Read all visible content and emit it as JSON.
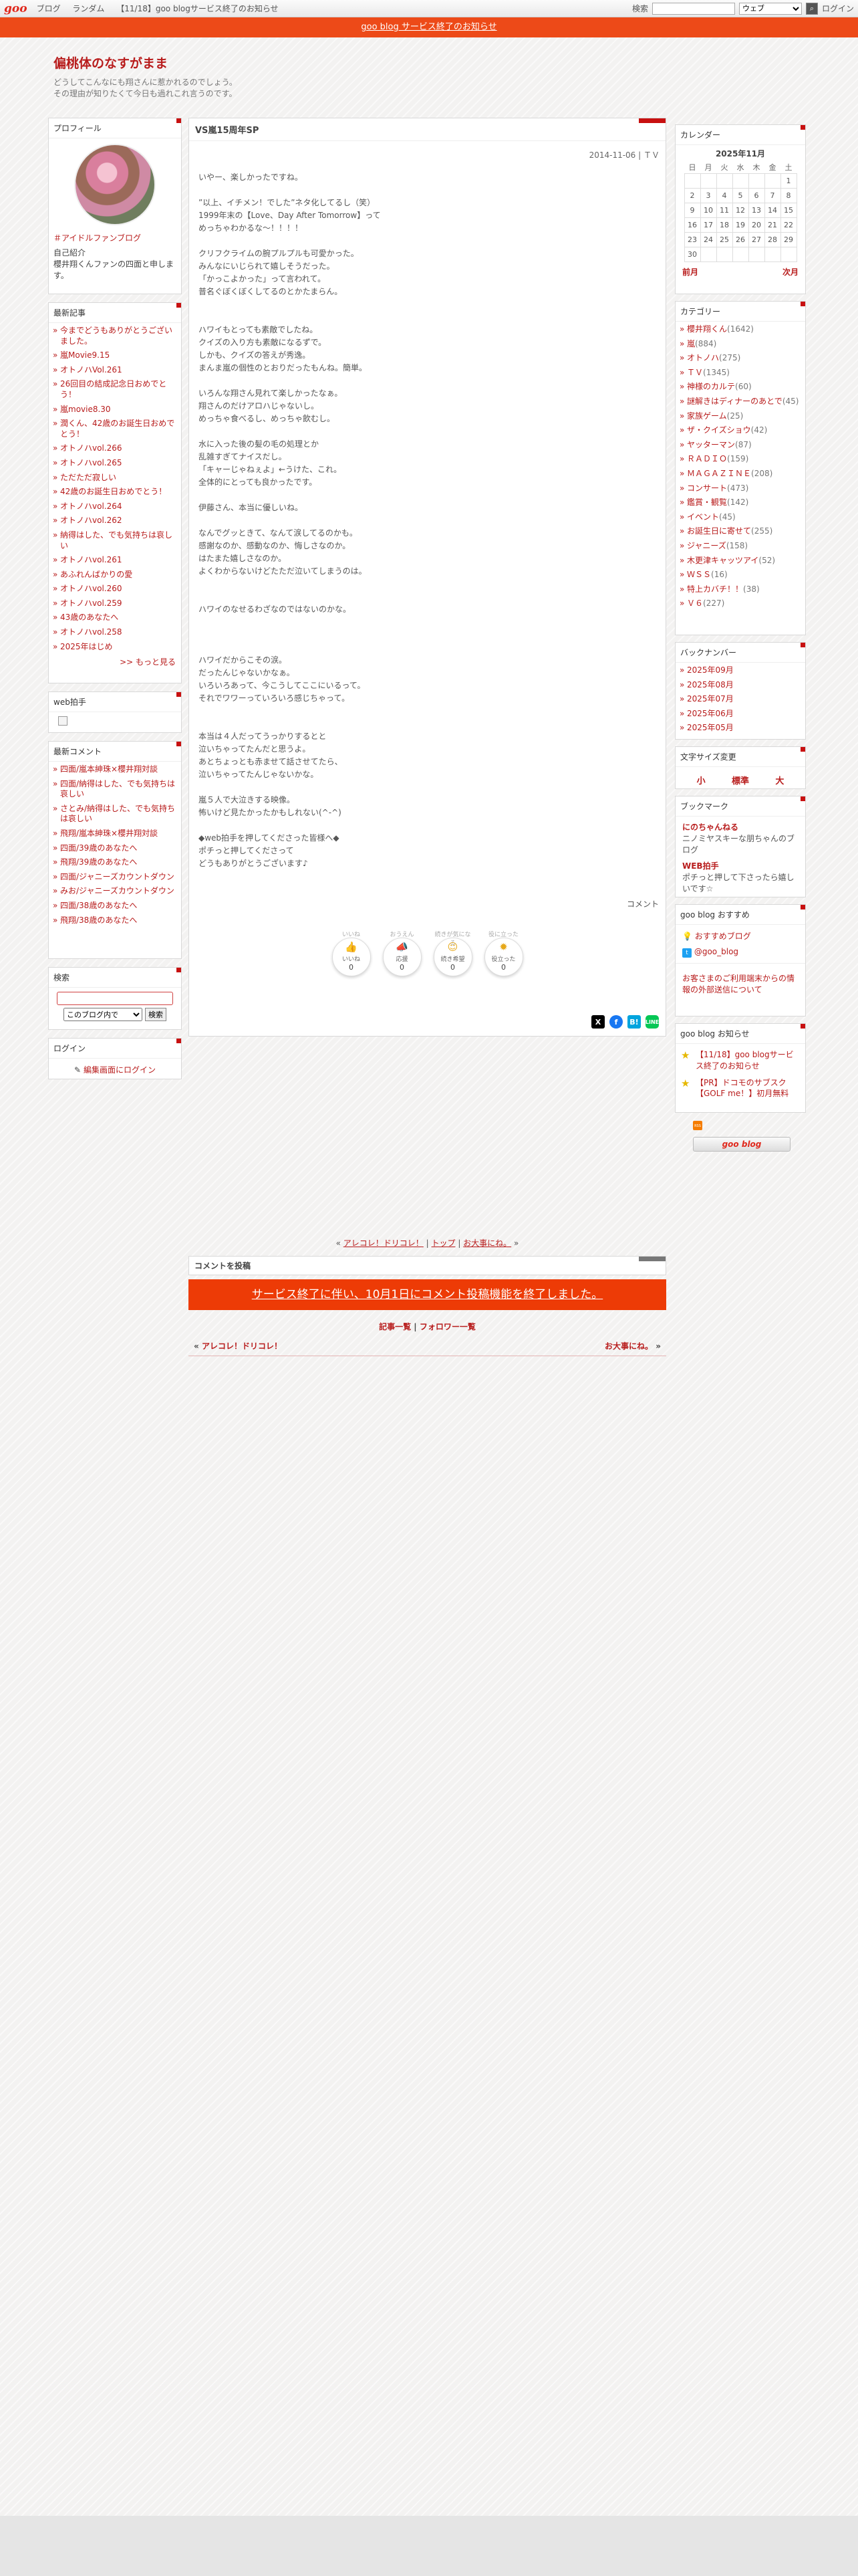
{
  "topbar": {
    "logo": "goo",
    "nav": [
      "ブログ",
      "ランダム",
      "【11/18】goo blogサービス終了のお知らせ"
    ],
    "search_label": "検索",
    "search_scope": "ウェブ",
    "login_label": "ログイン"
  },
  "notice": "goo blog サービス終了のお知らせ",
  "blog": {
    "title": "偏桃体のなすがまま",
    "desc1": "どうしてこんなにも翔さんに惹かれるのでしょう。",
    "desc2": "その理由が知りたくて今日も過れこれ言うのです。"
  },
  "profile": {
    "heading": "プロフィール",
    "link": "＃アイドルファンブログ",
    "intro_label": "自己紹介",
    "intro_text": "櫻井翔くんファンの四面と申します。"
  },
  "recent": {
    "heading": "最新記事",
    "items": [
      "今までどうもありがとうございました。",
      "嵐Movie9.15",
      "オトノハVol.261",
      "26回目の結成記念日おめでとう！",
      "嵐movie8.30",
      "潤くん、42歳のお誕生日おめでとう！",
      "オトノハvol.266",
      "オトノハvol.265",
      "ただただ寂しい",
      "42歳のお誕生日おめでとう！",
      "オトノハvol.264",
      "オトノハvol.262",
      "納得はした、でも気持ちは哀しい",
      "オトノハvol.261",
      "あふれんばかりの愛",
      "オトノハvol.260",
      "オトノハvol.259",
      "43歳のあなたへ",
      "オトノハvol.258",
      "2025年はじめ"
    ],
    "more": ">> もっと見る"
  },
  "webclap": {
    "heading": "web拍手"
  },
  "comments": {
    "heading": "最新コメント",
    "items": [
      "四面/嵐本紳珠×櫻井翔対談",
      "四面/納得はした、でも気持ちは哀しい",
      "さとみ/納得はした、でも気持ちは哀しい",
      "飛翔/嵐本紳珠×櫻井翔対談",
      "四面/39歳のあなたへ",
      "飛翔/39歳のあなたへ",
      "四面/ジャニーズカウントダウン",
      "みお/ジャニーズカウントダウン",
      "四面/38歳のあなたへ",
      "飛翔/38歳のあなたへ"
    ]
  },
  "search_box": {
    "heading": "検索",
    "scope": "このブログ内で",
    "button": "検索"
  },
  "login_box": {
    "heading": "ログイン",
    "link": "編集画面にログイン"
  },
  "article": {
    "title": "VS嵐15周年SP",
    "meta": "2014-11-06 | ＴＶ",
    "lines": [
      "いやー、楽しかったですね。",
      "",
      "”以上、イチメン！でした”ネタ化してるし（笑）",
      "1999年末の【Love、Day After Tomorrow】って",
      "めっちゃわかるな～！！！！",
      "",
      "クリフクライムの腕プルプルも可愛かった。",
      "みんなにいじられて嬉しそうだった。",
      "「かっこよかった」って言われて。",
      "普名ぐぼくぼくしてるのとかたまらん。",
      "",
      "",
      "ハワイもとっても素敵でしたね。",
      "クイズの入り方も素敵になるずで。",
      "しかも、クイズの答えが秀逸。",
      "まんま嵐の個性のとおりだったもんね。簡単。",
      "",
      "いろんな翔さん見れて楽しかったなぁ。",
      "翔さんのだけアロハじゃないし。",
      "めっちゃ食べるし、めっちゃ飲むし。",
      "",
      "水に入った後の髪の毛の処理とか",
      "乱雑すぎてナイスだし。",
      "「キャーじゃねぇよ」←うけた、これ。",
      "全体的にとっても良かったです。",
      "",
      "伊藤さん、本当に優しいね。",
      "",
      "なんでグッときて、なんて涙してるのかも。",
      "感謝なのか、感動なのか、悔しさなのか。",
      "はたまた嬉しさなのか。",
      "よくわからないけどたただ泣いてしまうのは。",
      "",
      "",
      "ハワイのなせるわざなのではないのかな。",
      "",
      "",
      "",
      "ハワイだからこその涙。",
      "だったんじゃないかなぁ。",
      "いろいろあって、今こうしてここにいるって。",
      "それでワワーっていろいろ感じちゃって。",
      "",
      "",
      "本当は４人だってうっかりするとと",
      "泣いちゃってたんだと思うよ。",
      "あとちょっとも赤ませて話させてたら、",
      "泣いちゃってたんじゃないかな。",
      "",
      "嵐５人で大泣きする映像。",
      "怖いけど見たかったかもしれない(^-^)",
      "",
      "◆web拍手を押してくださった皆様へ◆",
      "ポチっと押してくださって",
      "どうもありがとうございます♪"
    ],
    "comment_link": "コメント",
    "reactions": [
      {
        "top": "いいね",
        "icon": "thumbs-up-icon",
        "glyph": "👍",
        "label": "いいね",
        "count": "0"
      },
      {
        "top": "おうえん",
        "icon": "megaphone-icon",
        "glyph": "📣",
        "label": "応援",
        "count": "0"
      },
      {
        "top": "続きが気になる",
        "icon": "smile-icon",
        "glyph": "☺",
        "label": "続き希望",
        "count": "0"
      },
      {
        "top": "役に立った",
        "icon": "lightbulb-icon",
        "glyph": "✹",
        "label": "役立った",
        "count": "0"
      }
    ],
    "share": {
      "x": "X",
      "facebook": "f",
      "hatena": "B!",
      "line": "LINE"
    }
  },
  "pager": {
    "prev": "アレコレ！ドリコレ！",
    "top": "トップ",
    "next": "お大事にね。"
  },
  "post_comment": {
    "heading": "コメントを投稿",
    "notice": "サービス終了に伴い、10月1日にコメント投稿機能を終了しました。",
    "links": [
      "記事一覧",
      "フォロワー一覧"
    ],
    "prev": "アレコレ！ドリコレ！",
    "next": "お大事にね。"
  },
  "calendar": {
    "heading": "カレンダー",
    "month": "2025年11月",
    "weekdays": [
      "日",
      "月",
      "火",
      "水",
      "木",
      "金",
      "土"
    ],
    "weeks": [
      [
        "",
        "",
        "",
        "",
        "",
        "",
        "1"
      ],
      [
        "2",
        "3",
        "4",
        "5",
        "6",
        "7",
        "8"
      ],
      [
        "9",
        "10",
        "11",
        "12",
        "13",
        "14",
        "15"
      ],
      [
        "16",
        "17",
        "18",
        "19",
        "20",
        "21",
        "22"
      ],
      [
        "23",
        "24",
        "25",
        "26",
        "27",
        "28",
        "29"
      ],
      [
        "30",
        "",
        "",
        "",
        "",
        "",
        ""
      ]
    ],
    "prev": "前月",
    "next": "次月"
  },
  "categories": {
    "heading": "カテゴリー",
    "items": [
      {
        "name": "櫻井翔くん",
        "count": "(1642)"
      },
      {
        "name": "嵐",
        "count": "(884)"
      },
      {
        "name": "オトノハ",
        "count": "(275)"
      },
      {
        "name": "ＴＶ",
        "count": "(1345)"
      },
      {
        "name": "神様のカルテ",
        "count": "(60)"
      },
      {
        "name": "謎解きはディナーのあとで",
        "count": "(45)"
      },
      {
        "name": "家族ゲーム",
        "count": "(25)"
      },
      {
        "name": "ザ・クイズショウ",
        "count": "(42)"
      },
      {
        "name": "ヤッターマン",
        "count": "(87)"
      },
      {
        "name": "ＲＡＤＩＯ",
        "count": "(159)"
      },
      {
        "name": "ＭＡＧＡＺＩＮＥ",
        "count": "(208)"
      },
      {
        "name": "コンサート",
        "count": "(473)"
      },
      {
        "name": "鑑賞・観覧",
        "count": "(142)"
      },
      {
        "name": "イベント",
        "count": "(45)"
      },
      {
        "name": "お誕生日に寄せて",
        "count": "(255)"
      },
      {
        "name": "ジャニーズ",
        "count": "(158)"
      },
      {
        "name": "木更津キャッツアイ",
        "count": "(52)"
      },
      {
        "name": "ＷＳＳ",
        "count": "(16)"
      },
      {
        "name": "特上カバチ！！",
        "count": "(38)"
      },
      {
        "name": "Ｖ６",
        "count": "(227)"
      }
    ]
  },
  "backnumber": {
    "heading": "バックナンバー",
    "items": [
      "2025年09月",
      "2025年08月",
      "2025年07月",
      "2025年06月",
      "2025年05月"
    ]
  },
  "fontsize": {
    "heading": "文字サイズ変更",
    "small": "小",
    "normal": "標準",
    "large": "大"
  },
  "bookmark": {
    "heading": "ブックマーク",
    "items": [
      {
        "title": "にのちゃんねる",
        "desc": "ニノミヤスキーな朋ちゃんのブログ"
      },
      {
        "title": "WEB拍手",
        "desc": "ポチっと押して下さったら嬉しいです☆"
      }
    ]
  },
  "recommend": {
    "heading": "goo blog おすすめ",
    "item1": "おすすめブログ",
    "item2": "@goo_blog",
    "item3": "お客さまのご利用端末からの情報の外部送信について"
  },
  "news": {
    "heading": "goo blog お知らせ",
    "items": [
      "【11/18】goo blogサービス終了のお知らせ",
      "【PR】ドコモのサブスク【GOLF me！】初月無料"
    ]
  },
  "footer": {
    "rss": "RSS",
    "badge": "goo blog"
  }
}
